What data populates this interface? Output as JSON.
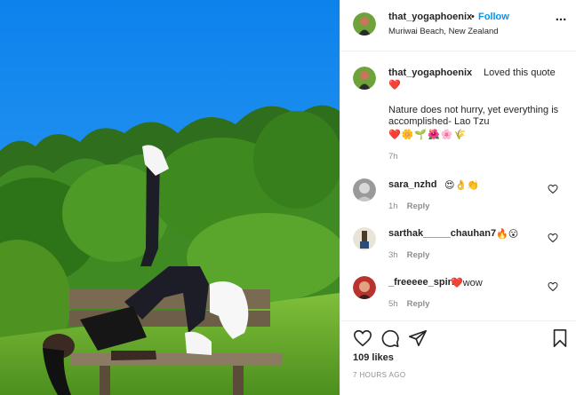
{
  "post": {
    "author": "that_yogaphoenix",
    "follow_separator": "•",
    "follow_label": "Follow",
    "location": "Muriwai Beach, New Zealand",
    "more_label": "..."
  },
  "caption": {
    "username": "that_yogaphoenix",
    "intro": "Loved this quote",
    "heart": "❤️",
    "quote": "Nature does not hurry, yet everything is accomplished- Lao Tzu",
    "emojis": "❤️🌼🌱🌺🌸🌾",
    "time": "7h"
  },
  "comments": [
    {
      "username": "sara_nzhd",
      "text": "😍👌👏",
      "time": "1h",
      "reply_label": "Reply"
    },
    {
      "username": "sarthak_____chauhan7",
      "text": "🔥😮",
      "time": "3h",
      "reply_label": "Reply"
    },
    {
      "username": "_freeeee_spirit",
      "text": "❤️wow",
      "time": "5h",
      "reply_label": "Reply"
    }
  ],
  "footer": {
    "likes": "109 likes",
    "posted": "7 HOURS AGO"
  },
  "icons": {
    "like": "heart-icon",
    "comment": "comment-icon",
    "share": "share-icon",
    "save": "bookmark-icon"
  },
  "colors": {
    "accent": "#0095f6",
    "text": "#262626",
    "muted": "#8e8e8e",
    "divider": "#efefef",
    "sky": "#1a8ff2"
  }
}
